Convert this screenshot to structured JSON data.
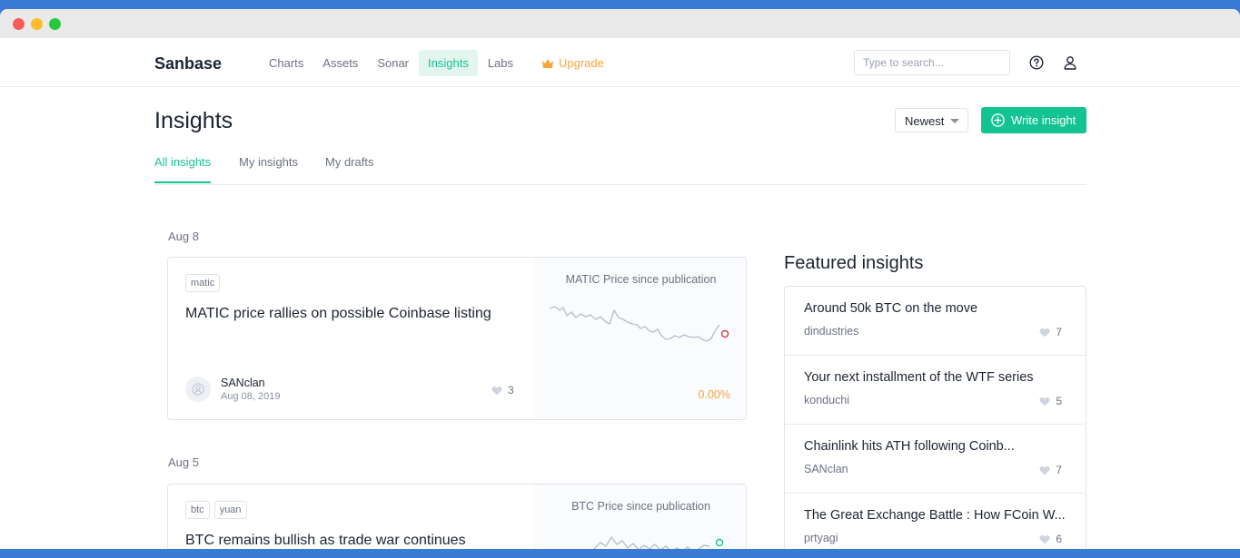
{
  "window": {
    "traffic_lights": [
      "close",
      "minimize",
      "maximize"
    ]
  },
  "nav": {
    "logo": "Sanbase",
    "items": [
      {
        "label": "Charts"
      },
      {
        "label": "Assets"
      },
      {
        "label": "Sonar"
      },
      {
        "label": "Insights",
        "active": true
      },
      {
        "label": "Labs"
      }
    ],
    "upgrade_label": "Upgrade",
    "search_placeholder": "Type to search..."
  },
  "page": {
    "title": "Insights",
    "sort_value": "Newest",
    "write_button": "Write insight",
    "tabs": [
      {
        "label": "All insights",
        "active": true
      },
      {
        "label": "My insights"
      },
      {
        "label": "My drafts"
      }
    ]
  },
  "insights": [
    {
      "date_group": "Aug 8",
      "tags": [
        "matic"
      ],
      "title": "MATIC price rallies on possible Coinbase listing",
      "author": "SANclan",
      "date": "Aug 08, 2019",
      "likes": "3",
      "chart_title": "MATIC Price since publication",
      "change": "0.00%"
    },
    {
      "date_group": "Aug 5",
      "tags": [
        "btc",
        "yuan"
      ],
      "title": "BTC remains bullish as trade war continues",
      "chart_title": "BTC Price since publication"
    }
  ],
  "featured": {
    "title": "Featured insights",
    "items": [
      {
        "title": "Around 50k BTC on the move",
        "author": "dindustries",
        "likes": "7"
      },
      {
        "title": "Your next installment of the WTF series",
        "author": "konduchi",
        "likes": "5"
      },
      {
        "title": "Chainlink hits ATH following Coinb...",
        "author": "SANclan",
        "likes": "7"
      },
      {
        "title": "The Great Exchange Battle : How FCoin W...",
        "author": "prtyagi",
        "likes": "6"
      }
    ]
  },
  "colors": {
    "accent": "#14c393",
    "upgrade": "#f7a53b",
    "text": "#1c2431",
    "muted": "#6b7280"
  }
}
